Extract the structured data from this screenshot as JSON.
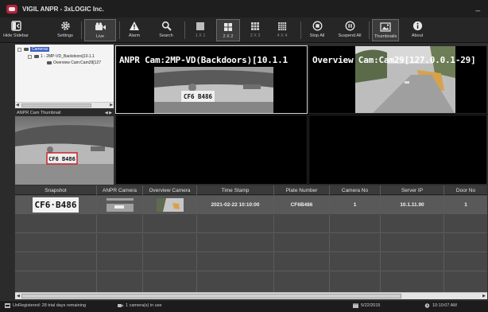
{
  "window": {
    "title": "VIGIL ANPR - 3xLOGIC Inc.",
    "minimize_glyph": "_"
  },
  "toolbar": {
    "items": [
      {
        "key": "hide_sidebar",
        "label": "Hide Sidebar",
        "icon": "hide-sidebar-icon"
      },
      {
        "key": "settings",
        "label": "Settings",
        "icon": "gear-icon"
      },
      {
        "key": "live",
        "label": "Live",
        "icon": "video-camera-icon"
      },
      {
        "key": "alarm",
        "label": "Alarm",
        "icon": "warning-icon"
      },
      {
        "key": "search",
        "label": "Search",
        "icon": "search-icon"
      },
      {
        "key": "layout_1x1",
        "label": "1 X 1",
        "icon": "grid-1x1-icon"
      },
      {
        "key": "layout_2x2",
        "label": "2 X 2",
        "icon": "grid-2x2-icon"
      },
      {
        "key": "layout_3x3",
        "label": "3 X 3",
        "icon": "grid-3x3-icon"
      },
      {
        "key": "layout_4x4",
        "label": "4 X 4",
        "icon": "grid-4x4-icon"
      },
      {
        "key": "stop_all",
        "label": "Stop All",
        "icon": "stop-icon"
      },
      {
        "key": "suspend_all",
        "label": "Suspend All",
        "icon": "pause-icon"
      },
      {
        "key": "thumbnails",
        "label": "Thumbnails",
        "icon": "thumbnails-icon"
      },
      {
        "key": "about",
        "label": "About",
        "icon": "info-icon"
      }
    ]
  },
  "tree": {
    "root": "Cameras",
    "child": "1 - 2MP-VD_Backdoors[10.1.1",
    "grandchild": "Overview Cam:Cam29[127"
  },
  "thumbnail_panel": {
    "title": "ANPR Cam Thumbnail",
    "nav": "◀ ▶",
    "plate_text": "CF6 B486"
  },
  "cameras": {
    "anpr_label": "ANPR Cam:2MP-VD(Backdoors)[10.1.1",
    "overview_label": "Overview Cam:Cam29[127.0.0.1-29]",
    "anpr_plate_text": "CF6 B486"
  },
  "table": {
    "columns": [
      "Snapshot",
      "ANPR Camera",
      "Overview Camera",
      "Time Stamp",
      "Plate Number",
      "Camera No",
      "Server IP",
      "Door No"
    ],
    "rows": [
      {
        "snapshot": "CF6·B486",
        "timestamp": "2021-02-22 10:10:00",
        "plate": "CF6B486",
        "camera_no": "1",
        "server_ip": "10.1.11.90",
        "door_no": "1"
      }
    ]
  },
  "status": {
    "registration": "UnRegistered: 28 trial days remaining",
    "cameras_in_use": "1 camera(s) in use",
    "date": "5/22/2015",
    "time": "10:10:07 AM"
  },
  "colors": {
    "tree_selection": "#3b5fc4",
    "plate_highlight": "#c8242c",
    "background": "#2f2f2f"
  }
}
